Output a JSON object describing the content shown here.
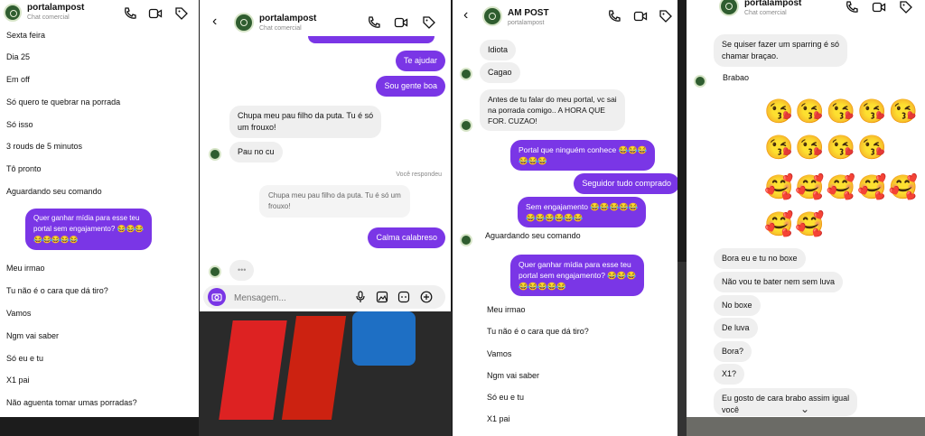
{
  "panel1": {
    "title": "portalampost",
    "subtitle": "Chat comercial",
    "messages_in_top": [
      "Sexta feira",
      "Dia 25",
      "Em off",
      "Só quero te quebrar na porrada",
      "Só isso",
      "3 rouds de 5 minutos",
      "Tô pronto",
      "Aguardando seu comando"
    ],
    "outgoing": "Quer ganhar mídia para esse teu\nportal sem engajamento? 😂😂😂\n😂😂😂😂😂",
    "messages_in_bottom": [
      "Meu irmao",
      "Tu não é o cara que dá tiro?",
      "Vamos",
      "Ngm vai saber",
      "Só eu e tu",
      "X1 pai",
      "Não aguenta tomar umas porradas?"
    ]
  },
  "panel2": {
    "title": "portalampost",
    "subtitle": "Chat comercial",
    "out1": "Te ajudar",
    "out2": "Sou gente boa",
    "in1": "Chupa meu pau filho da puta. Tu é só\num frouxo!",
    "in2": "Pau no cu",
    "replied_label": "Você respondeu",
    "reply_quote": "Chupa meu pau filho da puta. Tu é só um\nfrouxo!",
    "out3": "Calma calabreso",
    "typing": "•••",
    "composer_placeholder": "Mensagem..."
  },
  "panel3": {
    "title": "AM POST",
    "subtitle": "portalampost",
    "in1": "Idiota",
    "in2": "Cagao",
    "in3": "Antes de tu falar do meu portal, vc sai\nna porrada comigo.. A HORA QUE\nFOR. CUZAO!",
    "out1": "Portal que ninguém conhece 😂😂😂\n😂😂😂",
    "out2": "Seguidor tudo comprado",
    "out3": "Sem engajamento 😂😂😂😂😂\n😂😂😂😂😂😂",
    "in4": "Aguardando seu comando",
    "out4": "Quer ganhar mídia para esse teu\nportal sem engajamento? 😂😂😂\n😂😂😂😂😂",
    "messages_in_bottom": [
      "Meu irmao",
      "Tu não é o cara que dá tiro?",
      "Vamos",
      "Ngm vai saber",
      "Só eu e tu",
      "X1 pai"
    ]
  },
  "panel4": {
    "title": "portalampost",
    "subtitle": "Chat comercial",
    "in1": "Se quiser fazer um sparring é só\nchamar braçao.",
    "in2": "Brabao",
    "emoji_row1": "😘😘😘😘😘",
    "emoji_row2": "😘😘😘😘",
    "emoji_row3": "🥰🥰🥰🥰🥰",
    "emoji_row4": "🥰🥰",
    "messages_in": [
      "Bora eu e tu no boxe",
      "Não vou te bater nem sem luva",
      "No boxe",
      "De luva",
      "Bora?",
      "X1?"
    ],
    "last": "Eu gosto de cara brabo assim igual\nvocê"
  },
  "colors": {
    "outgoing": "#7a36e6",
    "incoming": "#efefef"
  }
}
